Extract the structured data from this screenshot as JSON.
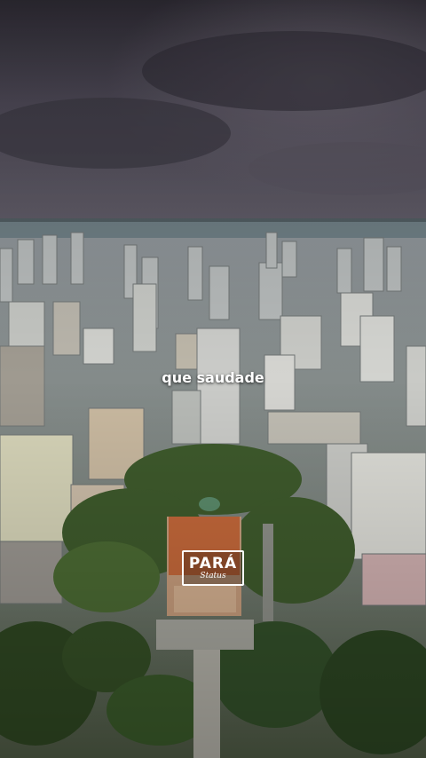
{
  "overlay": {
    "caption": "que saudade",
    "logo_main": "PARÁ",
    "logo_sub": "Status"
  },
  "palette": {
    "sky_top": "#3a3642",
    "sky_mid": "#4e4a58",
    "sky_low": "#5a5661",
    "river": "#6f8087",
    "city": "#9aa0a4",
    "trees": "#3f5a2e",
    "theatre_roof": "#c46a3c",
    "theatre_wall": "#c9a07e"
  }
}
